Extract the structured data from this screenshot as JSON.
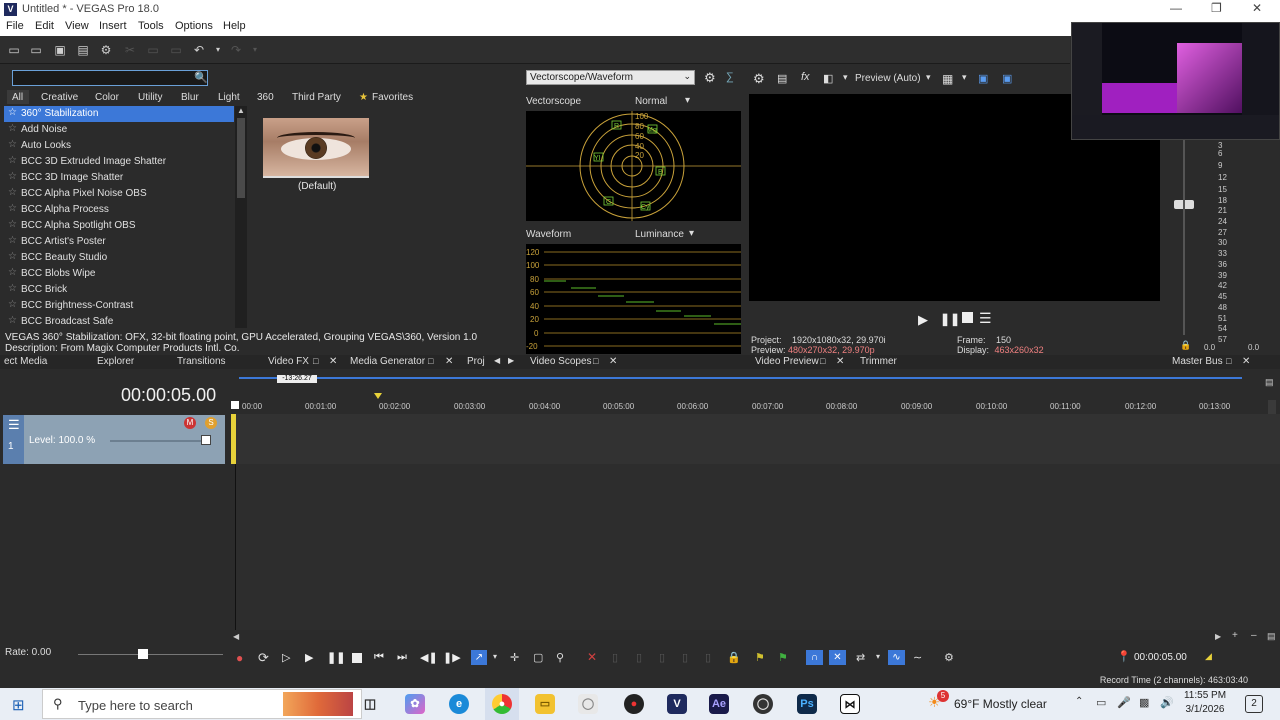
{
  "window": {
    "title": "Untitled * - VEGAS Pro 18.0",
    "app_icon": "V"
  },
  "menu": [
    "File",
    "Edit",
    "View",
    "Insert",
    "Tools",
    "Options",
    "Help"
  ],
  "fx": {
    "search_placeholder": "",
    "tabs": [
      "All",
      "Creative",
      "Color",
      "Utility",
      "Blur",
      "Light",
      "360",
      "Third Party",
      "Favorites"
    ],
    "items": [
      "360° Stabilization",
      "Add Noise",
      "Auto Looks",
      "BCC 3D Extruded Image Shatter",
      "BCC 3D Image Shatter",
      "BCC Alpha Pixel Noise OBS",
      "BCC Alpha Process",
      "BCC Alpha Spotlight OBS",
      "BCC Artist's Poster",
      "BCC Beauty Studio",
      "BCC Blobs Wipe",
      "BCC Brick",
      "BCC Brightness-Contrast",
      "BCC Broadcast Safe"
    ],
    "preset_label": "(Default)",
    "desc_line1": "VEGAS 360° Stabilization: OFX, 32-bit floating point, GPU Accelerated, Grouping VEGAS\\360, Version 1.0",
    "desc_line2": "Description: From Magix Computer Products Intl. Co."
  },
  "dock_tabs": {
    "project_media": "ect Media",
    "explorer": "Explorer",
    "transitions": "Transitions",
    "video_fx": "Video FX",
    "media_generator": "Media Generator",
    "proj_cut": "Proj",
    "video_scopes": "Video Scopes",
    "video_preview": "Video Preview",
    "trimmer": "Trimmer",
    "master_bus": "Master Bus"
  },
  "scopes": {
    "selector": "Vectorscope/Waveform",
    "vectorscope_label": "Vectorscope",
    "vectorscope_mode": "Normal",
    "waveform_label": "Waveform",
    "waveform_mode": "Luminance",
    "wf_ticks": [
      "120",
      "100",
      "80",
      "60",
      "40",
      "20",
      "0",
      "-20"
    ],
    "vs_marks": [
      "100",
      "80",
      "60",
      "40",
      "20",
      "R",
      "Mg",
      "YI",
      "B",
      "G",
      "Cy"
    ]
  },
  "preview": {
    "mode": "Preview (Auto)",
    "project_label": "Project:",
    "project_value": "1920x1080x32, 29.970i",
    "preview_label": "Preview:",
    "preview_value": "480x270x32, 29.970p",
    "frame_label": "Frame:",
    "frame_value": "150",
    "display_label": "Display:",
    "display_value": "463x260x32"
  },
  "meter": {
    "ticks": [
      "3",
      "6",
      "9",
      "12",
      "15",
      "18",
      "21",
      "24",
      "27",
      "30",
      "33",
      "36",
      "39",
      "42",
      "45",
      "48",
      "51",
      "54",
      "57"
    ],
    "left_val": "0.0",
    "right_val": "0.0"
  },
  "timeline": {
    "timecode": "00:00:05.00",
    "loop_region": "-13:26.27",
    "ruler": [
      "00:00",
      "00:01:00",
      "00:02:00",
      "00:03:00",
      "00:04:00",
      "00:05:00",
      "00:06:00",
      "00:07:00",
      "00:08:00",
      "00:09:00",
      "00:10:00",
      "00:11:00",
      "00:12:00",
      "00:13:00"
    ],
    "track_level": "Level: 100.0 %",
    "rate": "Rate: 0.00",
    "cursor_time": "00:00:05.00",
    "record_time": "Record Time (2 channels): 463:03:40"
  },
  "taskbar": {
    "search_placeholder": "Type here to search",
    "weather": "69°F  Mostly clear",
    "weather_badge": "5",
    "time": "11:55 PM",
    "date": "3/1/2026",
    "notif_count": "2"
  }
}
